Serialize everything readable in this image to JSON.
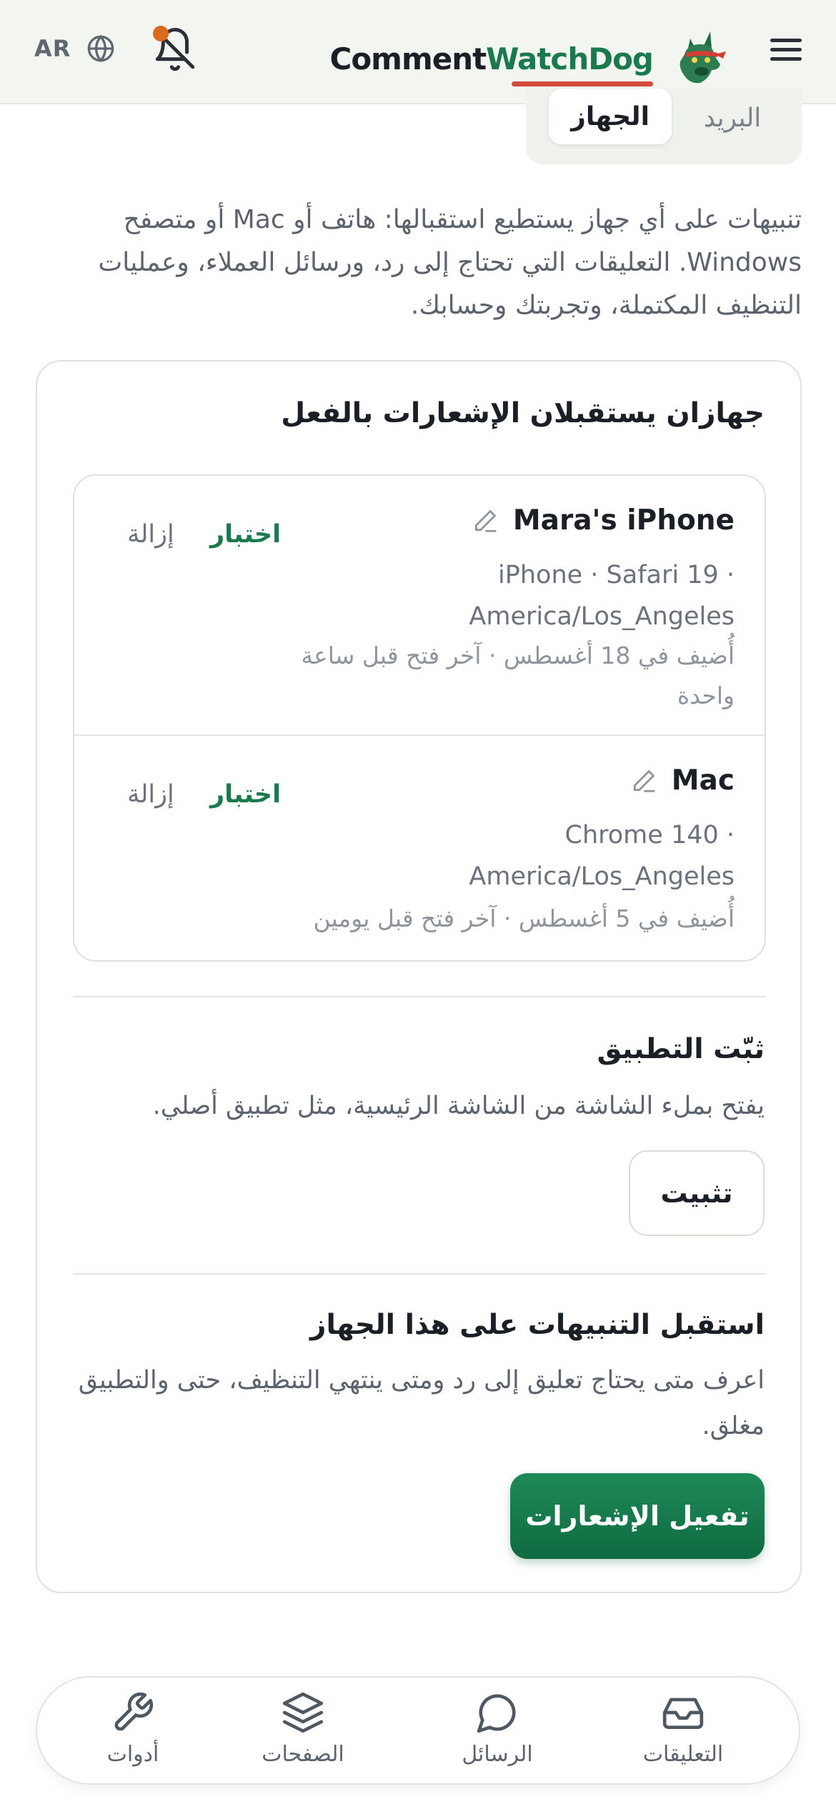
{
  "header": {
    "lang_code": "AR",
    "brand_part1": "Comment",
    "brand_part2": "WatchDog"
  },
  "tabs": [
    {
      "label": "البريد"
    },
    {
      "label": "الجهاز"
    }
  ],
  "intro_text": "تنبيهات على أي جهاز يستطيع استقبالها: هاتف أو Mac أو متصفح Windows. التعليقات التي تحتاج إلى رد، ورسائل العملاء، وعمليات التنظيف المكتملة، وتجربتك وحسابك.",
  "devices_section": {
    "title": "جهازان يستقبلان الإشعارات بالفعل",
    "test_label": "اختبار",
    "remove_label": "إزالة",
    "devices": [
      {
        "name": "Mara's iPhone",
        "meta": "iPhone · Safari 19 · America/Los_Angeles",
        "added": "أُضيف في 18 أغسطس · آخر فتح قبل ساعة واحدة"
      },
      {
        "name": "Mac",
        "meta": "Chrome 140 · America/Los_Angeles",
        "added": "أُضيف في 5 أغسطس · آخر فتح قبل يومين"
      }
    ]
  },
  "install_section": {
    "title": "ثبّت التطبيق",
    "desc": "يفتح بملء الشاشة من الشاشة الرئيسية، مثل تطبيق أصلي.",
    "button": "تثبيت"
  },
  "notify_section": {
    "title": "استقبل التنبيهات على هذا الجهاز",
    "desc": "اعرف متى يحتاج تعليق إلى رد ومتى ينتهي التنظيف، حتى والتطبيق مغلق.",
    "button": "تفعيل الإشعارات"
  },
  "bottom_nav": [
    {
      "label": "التعليقات",
      "icon": "inbox-icon"
    },
    {
      "label": "الرسائل",
      "icon": "chat-bubble-icon"
    },
    {
      "label": "الصفحات",
      "icon": "layers-icon"
    },
    {
      "label": "أدوات",
      "icon": "wrench-icon"
    }
  ],
  "colors": {
    "accent_green": "#1a7a4e",
    "notification_dot": "#d96a1f",
    "brand_underline": "#d24a3a"
  }
}
